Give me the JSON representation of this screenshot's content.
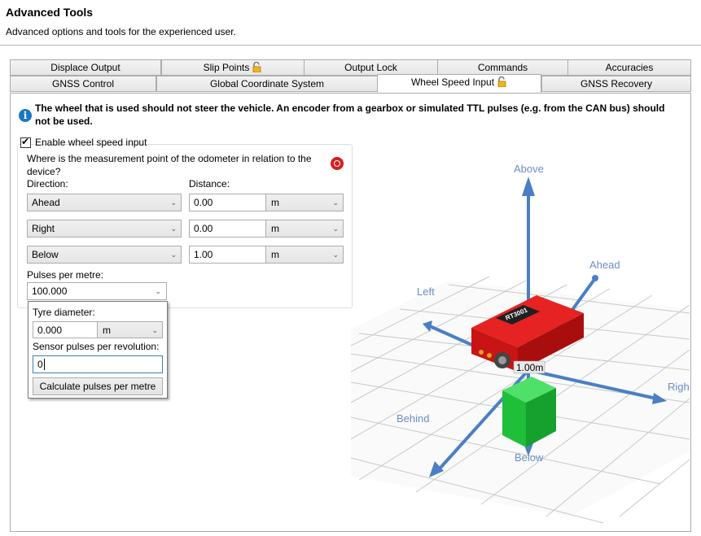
{
  "header": {
    "title": "Advanced Tools",
    "subtitle": "Advanced options and tools for the experienced user."
  },
  "tabs": {
    "row1": [
      {
        "label": "Displace Output",
        "locked": false
      },
      {
        "label": "Slip Points",
        "locked": true
      },
      {
        "label": "Output Lock",
        "locked": false
      },
      {
        "label": "Commands",
        "locked": false
      },
      {
        "label": "Accuracies",
        "locked": false
      }
    ],
    "row2": [
      {
        "label": "GNSS Control",
        "locked": false
      },
      {
        "label": "Global Coordinate System",
        "locked": false
      },
      {
        "label": "Wheel Speed Input",
        "locked": true,
        "active": true
      },
      {
        "label": "GNSS Recovery",
        "locked": false
      }
    ]
  },
  "info": {
    "text": "The wheel that is used should not steer the vehicle. An encoder from a gearbox or simulated TTL pulses (e.g. from the CAN bus) should not be used."
  },
  "wheel_speed": {
    "enable_label": "Enable wheel speed input",
    "enabled": true,
    "question": "Where is the measurement point of the odometer in relation to the device?",
    "direction_label": "Direction:",
    "distance_label": "Distance:",
    "rows": [
      {
        "direction": "Ahead",
        "distance": "0.00",
        "unit": "m"
      },
      {
        "direction": "Right",
        "distance": "0.00",
        "unit": "m"
      },
      {
        "direction": "Below",
        "distance": "1.00",
        "unit": "m"
      }
    ],
    "pulses_label": "Pulses per metre:",
    "pulses_value": "100.000"
  },
  "popup": {
    "tyre_label": "Tyre diameter:",
    "tyre_value": "0.000",
    "tyre_unit": "m",
    "sensor_label": "Sensor pulses per revolution:",
    "sensor_value": "0",
    "calc_button": "Calculate pulses per metre"
  },
  "scene": {
    "axis_labels": {
      "above": "Above",
      "ahead": "Ahead",
      "left": "Left",
      "right": "Right",
      "behind": "Behind",
      "below": "Below"
    },
    "device_label": "RT3001",
    "distance_marker": "1.00m",
    "colors": {
      "axis": "#4a7fc4",
      "device": "#e01818",
      "cube": "#1fbf3a",
      "label": "#6b8fc7"
    }
  }
}
